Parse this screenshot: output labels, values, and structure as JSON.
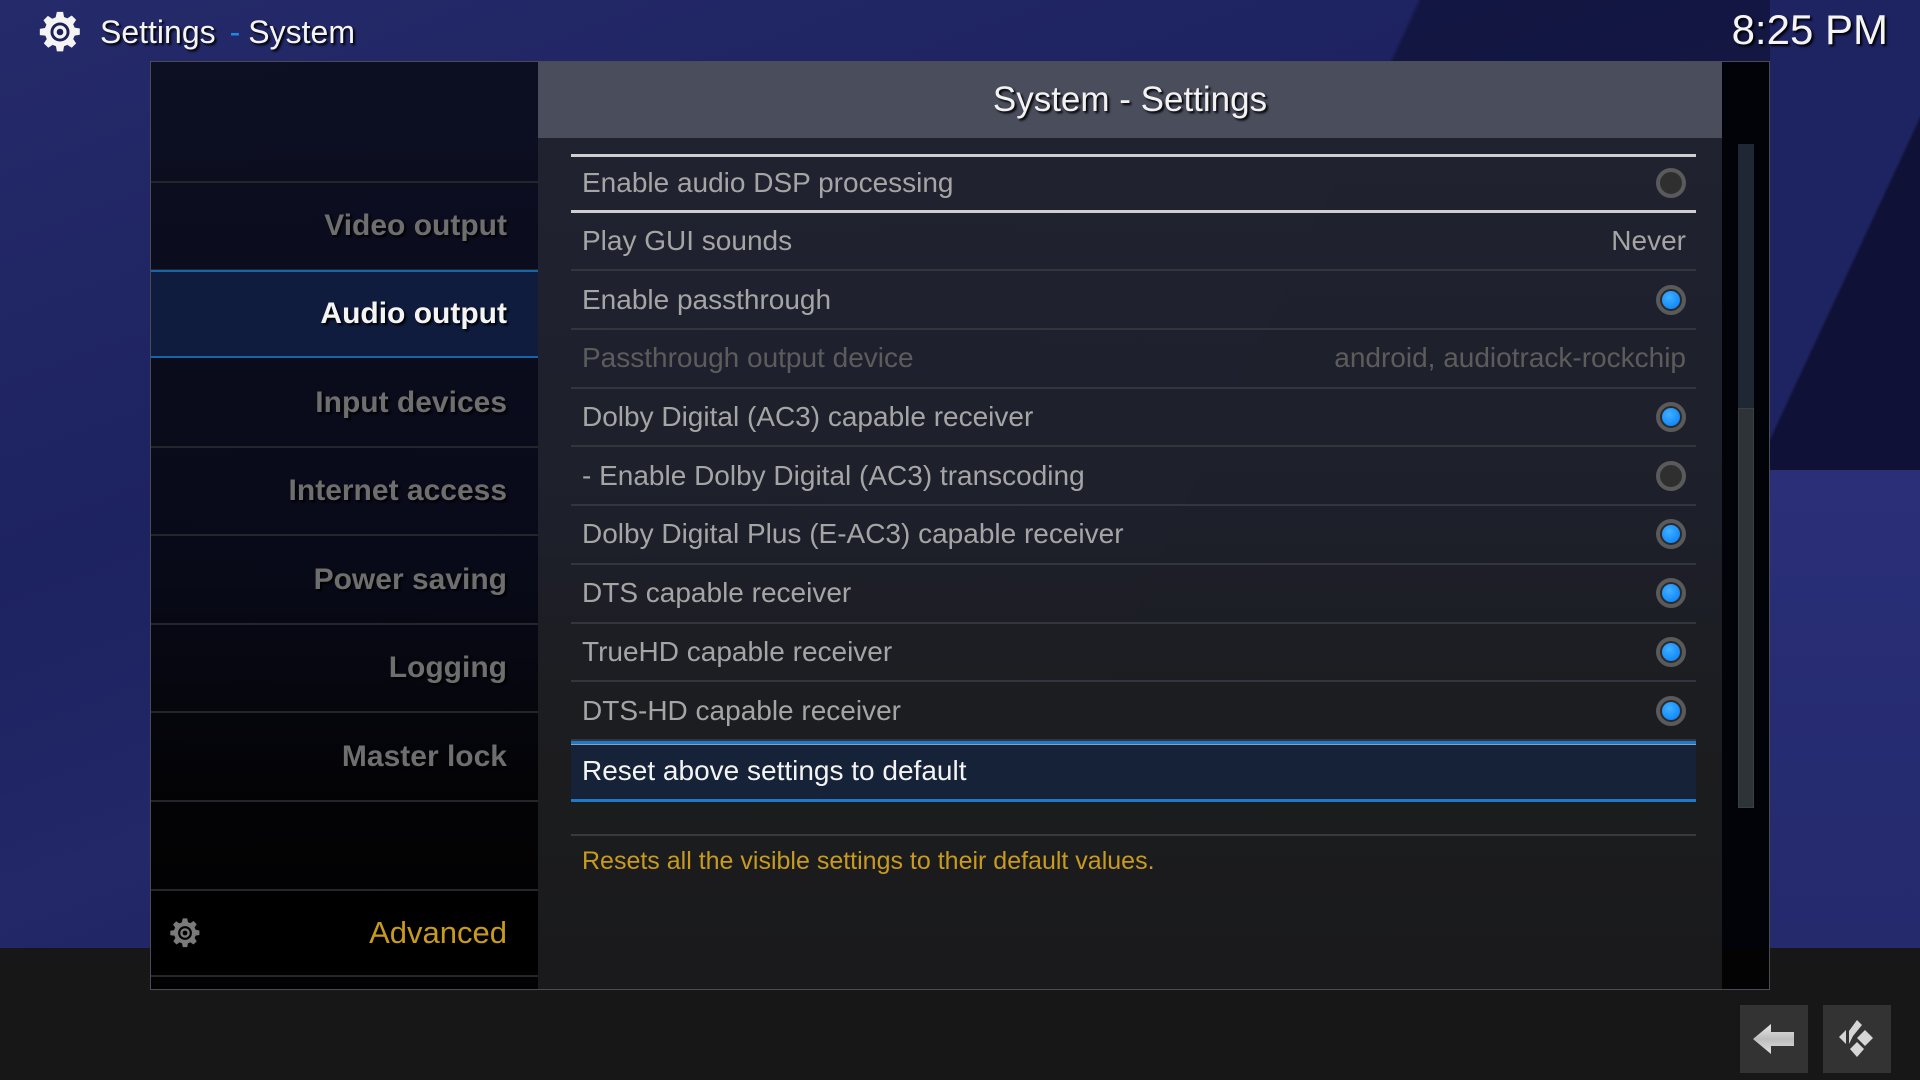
{
  "header": {
    "icon": "gear-icon",
    "title": "Settings",
    "separator": "-",
    "subtitle": "System",
    "clock": "8:25 PM"
  },
  "sidebar": {
    "items": [
      {
        "label": "Video output",
        "active": false
      },
      {
        "label": "Audio output",
        "active": true
      },
      {
        "label": "Input devices",
        "active": false
      },
      {
        "label": "Internet access",
        "active": false
      },
      {
        "label": "Power saving",
        "active": false
      },
      {
        "label": "Logging",
        "active": false
      },
      {
        "label": "Master lock",
        "active": false
      }
    ],
    "level": {
      "icon": "gear-icon",
      "label": "Advanced"
    }
  },
  "main": {
    "title": "System - Settings",
    "rows": [
      {
        "label": "Enable audio DSP processing",
        "type": "toggle",
        "value": false,
        "group": true
      },
      {
        "label": "Play GUI sounds",
        "type": "value",
        "value": "Never"
      },
      {
        "label": "Enable passthrough",
        "type": "toggle",
        "value": true
      },
      {
        "label": "Passthrough output device",
        "type": "value",
        "value": "android, audiotrack-rockchip",
        "disabled": true
      },
      {
        "label": "Dolby Digital (AC3) capable receiver",
        "type": "toggle",
        "value": true
      },
      {
        "label": "- Enable Dolby Digital (AC3) transcoding",
        "type": "toggle",
        "value": false
      },
      {
        "label": "Dolby Digital Plus (E-AC3) capable receiver",
        "type": "toggle",
        "value": true
      },
      {
        "label": "DTS capable receiver",
        "type": "toggle",
        "value": true
      },
      {
        "label": "TrueHD capable receiver",
        "type": "toggle",
        "value": true
      },
      {
        "label": "DTS-HD capable receiver",
        "type": "toggle",
        "value": true
      }
    ],
    "reset": {
      "label": "Reset above settings to default"
    },
    "description": "Resets all the visible settings to their default values.",
    "scroll": {
      "position_fraction": 0.4,
      "visible_fraction": 0.6
    }
  },
  "bottom_buttons": [
    {
      "name": "back",
      "icon": "back-arrow-icon"
    },
    {
      "name": "home",
      "icon": "kodi-logo-icon"
    }
  ],
  "colors": {
    "accent_blue": "#1f78c8",
    "toggle_on": "#1a90ff",
    "highlight_text": "#c89b1e"
  }
}
